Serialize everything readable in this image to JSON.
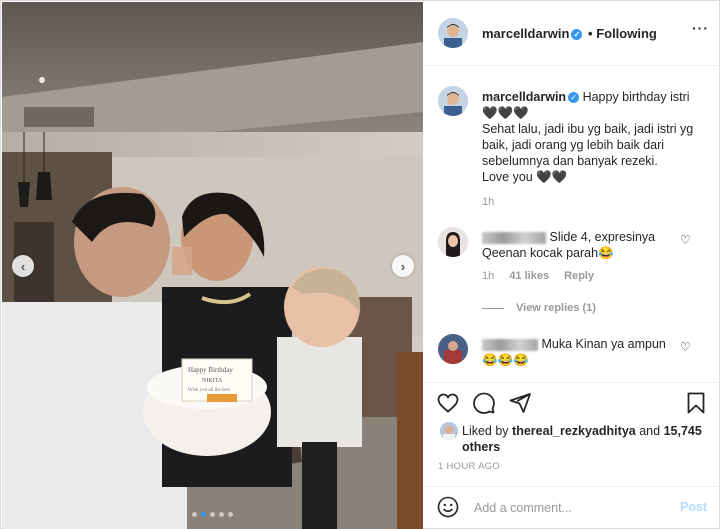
{
  "header": {
    "username": "marcelldarwin",
    "separator": "•",
    "following_label": "Following",
    "more_label": "···"
  },
  "caption": {
    "username": "marcelldarwin",
    "text_line1": "Happy birthday istri",
    "hearts1": "🖤🖤🖤",
    "body": "Sehat lalu, jadi ibu yg baik, jadi istri yg baik, jadi orang yg lebih baik dari sebelumnya dan banyak rezeki.",
    "love": "Love you 🖤🖤",
    "time": "1h"
  },
  "comments": [
    {
      "text": "Slide 4, expresinya Qeenan kocak parah😂",
      "time": "1h",
      "likes": "41 likes",
      "reply_label": "Reply",
      "view_replies": "View replies (1)"
    },
    {
      "text": "Muka Kinan ya ampun 😂😂😂"
    }
  ],
  "likes": {
    "prefix": "Liked by",
    "user": "thereal_rezkyadhitya",
    "middle": "and",
    "count": "15,745 others"
  },
  "timestamp": "1 HOUR AGO",
  "add_comment": {
    "placeholder": "Add a comment...",
    "post_label": "Post"
  },
  "photo": {
    "card_text": "Happy Birthday",
    "card_name": "NIKITA",
    "card_sub": "Wish you all the best",
    "prev_label": "‹",
    "next_label": "›"
  },
  "colors": {
    "accent": "#3897f0",
    "post_disabled": "#b3dbff",
    "muted": "#999999",
    "text": "#262626"
  },
  "carousel": {
    "slides": 5,
    "active": 1
  }
}
